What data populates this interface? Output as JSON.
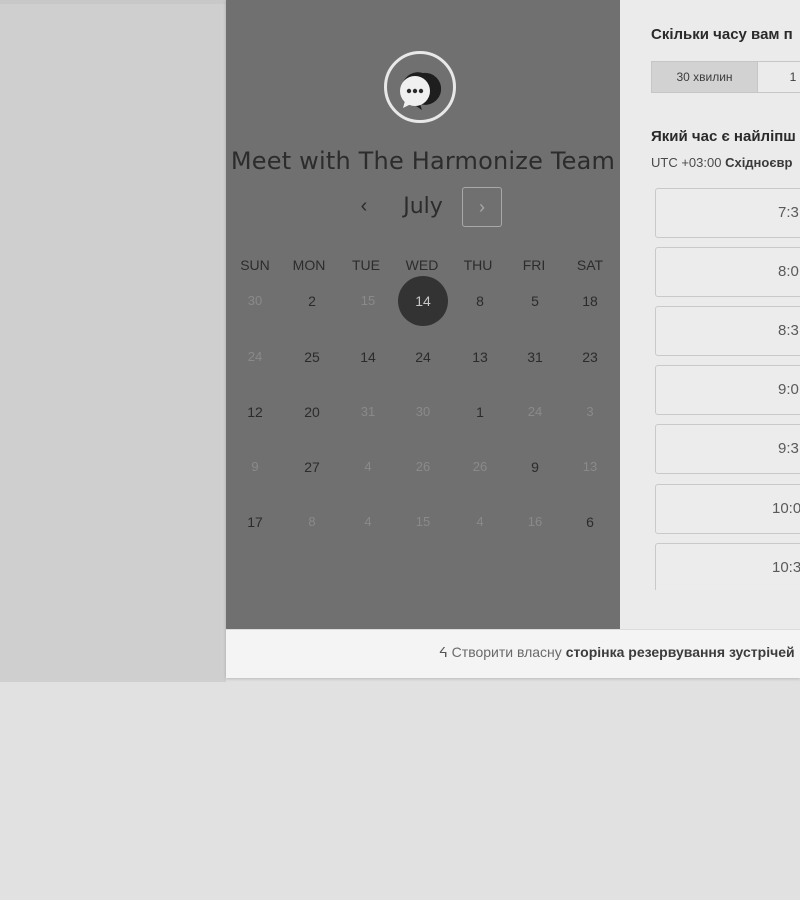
{
  "calendar": {
    "title": "Meet with The Harmonize Team",
    "month": "July",
    "prev_icon": "chevron-left-icon",
    "next_icon": "chevron-right-icon",
    "weekdays": [
      "SUN",
      "MON",
      "TUE",
      "WED",
      "THU",
      "FRI",
      "SAT"
    ],
    "weeks": [
      [
        {
          "d": "30",
          "m": 1
        },
        {
          "d": "2",
          "m": 0
        },
        {
          "d": "15",
          "m": 1
        },
        {
          "d": "14",
          "m": 0,
          "sel": 1
        },
        {
          "d": "8",
          "m": 0
        },
        {
          "d": "5",
          "m": 0
        },
        {
          "d": "18",
          "m": 0
        }
      ],
      [
        {
          "d": "24",
          "m": 1
        },
        {
          "d": "25",
          "m": 0
        },
        {
          "d": "14",
          "m": 0
        },
        {
          "d": "24",
          "m": 0
        },
        {
          "d": "13",
          "m": 0
        },
        {
          "d": "31",
          "m": 0
        },
        {
          "d": "23",
          "m": 0
        }
      ],
      [
        {
          "d": "12",
          "m": 0
        },
        {
          "d": "20",
          "m": 0
        },
        {
          "d": "31",
          "m": 1
        },
        {
          "d": "30",
          "m": 1
        },
        {
          "d": "1",
          "m": 0
        },
        {
          "d": "24",
          "m": 1
        },
        {
          "d": "3",
          "m": 1
        }
      ],
      [
        {
          "d": "9",
          "m": 1
        },
        {
          "d": "27",
          "m": 0
        },
        {
          "d": "4",
          "m": 1
        },
        {
          "d": "26",
          "m": 1
        },
        {
          "d": "26",
          "m": 1
        },
        {
          "d": "9",
          "m": 0
        },
        {
          "d": "13",
          "m": 1
        }
      ],
      [
        {
          "d": "17",
          "m": 0
        },
        {
          "d": "8",
          "m": 1
        },
        {
          "d": "4",
          "m": 1
        },
        {
          "d": "15",
          "m": 1
        },
        {
          "d": "4",
          "m": 1
        },
        {
          "d": "16",
          "m": 1
        },
        {
          "d": "6",
          "m": 0
        }
      ]
    ]
  },
  "booking": {
    "duration_question": "Скільки часу вам п",
    "durations": [
      "30 хвилин",
      "1"
    ],
    "time_question": "Який час є найліпш",
    "timezone_offset": "UTC +03:00",
    "timezone_name": "Східноєвр",
    "slots": [
      "7:3",
      "8:0",
      "8:3",
      "9:0",
      "9:3",
      "10:0",
      "10:3"
    ]
  },
  "footer": {
    "prefix": "Створити власну",
    "link": "сторінка резервування зустрічей"
  },
  "colors": {
    "calendar_panel": "#707070",
    "selected_day": "#333333",
    "right_panel": "#ebebeb"
  }
}
